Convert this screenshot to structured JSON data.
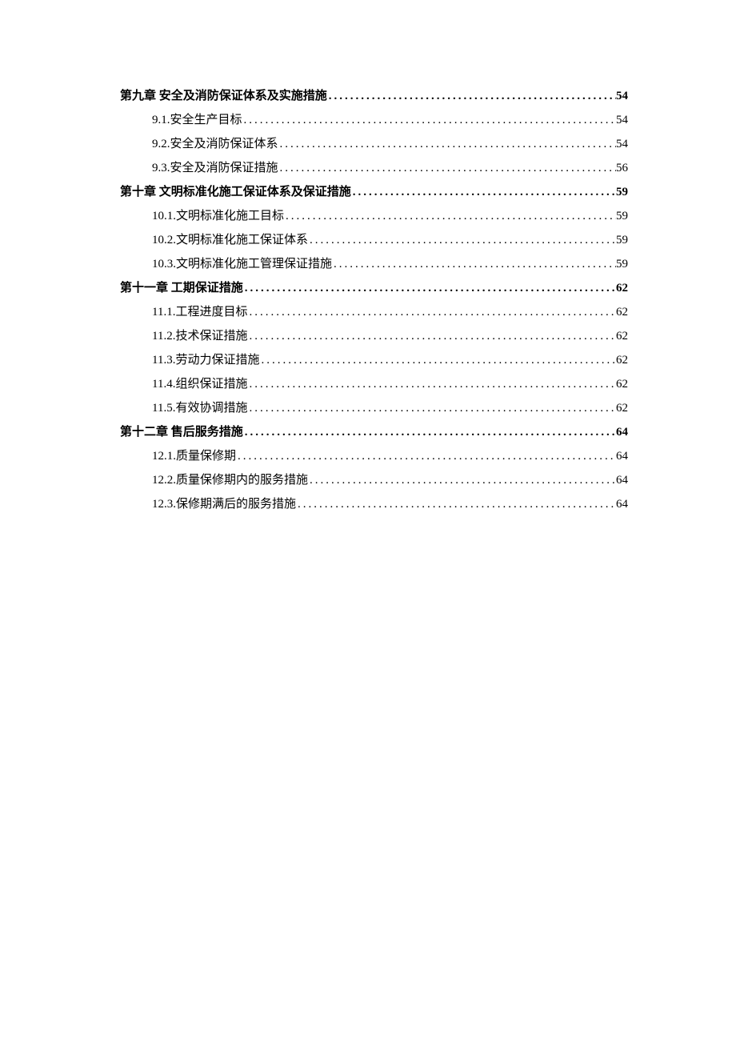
{
  "toc": [
    {
      "level": "chapter",
      "label": "第九章 安全及消防保证体系及实施措施",
      "page": "54"
    },
    {
      "level": "sub",
      "label": "9.1.安全生产目标",
      "page": "54"
    },
    {
      "level": "sub",
      "label": "9.2.安全及消防保证体系",
      "page": "54"
    },
    {
      "level": "sub",
      "label": "9.3.安全及消防保证措施",
      "page": "56"
    },
    {
      "level": "chapter",
      "label": "第十章 文明标准化施工保证体系及保证措施",
      "page": "59"
    },
    {
      "level": "sub",
      "label": "10.1.文明标准化施工目标",
      "page": "59"
    },
    {
      "level": "sub",
      "label": "10.2.文明标准化施工保证体系",
      "page": "59"
    },
    {
      "level": "sub",
      "label": "10.3.文明标准化施工管理保证措施",
      "page": "59"
    },
    {
      "level": "chapter",
      "label": "第十一章   工期保证措施",
      "page": "62"
    },
    {
      "level": "sub",
      "label": "11.1.工程进度目标",
      "page": "62"
    },
    {
      "level": "sub",
      "label": "11.2.技术保证措施",
      "page": "62"
    },
    {
      "level": "sub",
      "label": "11.3.劳动力保证措施",
      "page": "62"
    },
    {
      "level": "sub",
      "label": "11.4.组织保证措施",
      "page": "62"
    },
    {
      "level": "sub",
      "label": "11.5.有效协调措施",
      "page": "62"
    },
    {
      "level": "chapter",
      "label": "第十二章 售后服务措施",
      "page": "64"
    },
    {
      "level": "sub",
      "label": "12.1.质量保修期",
      "page": "64"
    },
    {
      "level": "sub",
      "label": "12.2.质量保修期内的服务措施",
      "page": "64"
    },
    {
      "level": "sub",
      "label": "12.3.保修期满后的服务措施",
      "page": "64"
    }
  ]
}
